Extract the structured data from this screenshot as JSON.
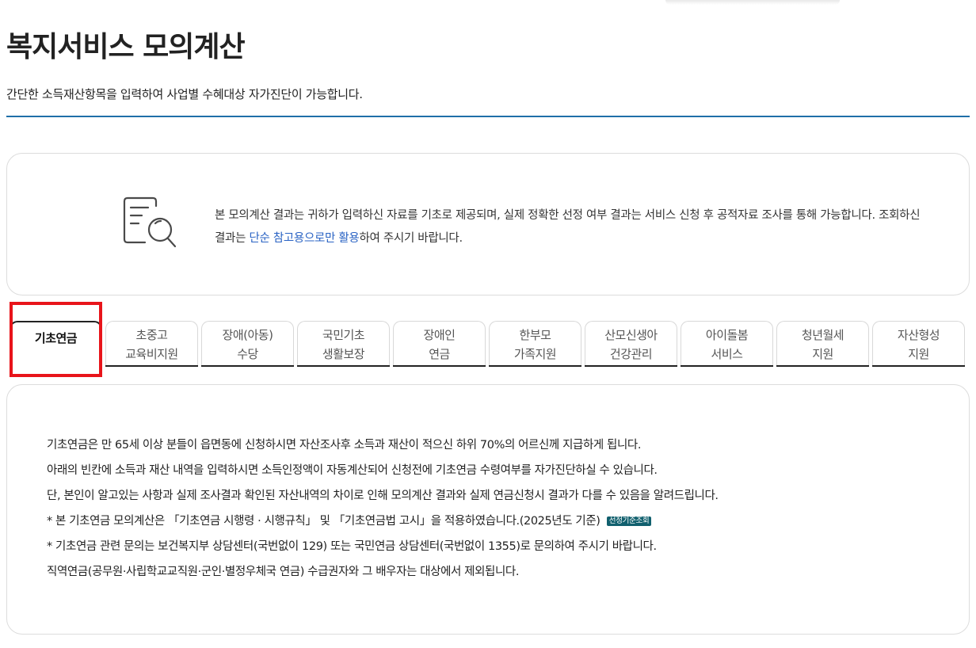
{
  "page": {
    "title": "복지서비스 모의계산",
    "description": "간단한 소득재산항목을 입력하여 사업별 수혜대상 자가진단이 가능합니다."
  },
  "notice": {
    "icon": "document-search-icon",
    "text_before": "본 모의계산 결과는 귀하가 입력하신 자료를 기초로 제공되며, 실제 정확한 선정 여부 결과는 서비스 신청 후 공적자료 조사를 통해 가능합니다. 조회하신 결과는 ",
    "highlight": "단순 참고용으로만 활용",
    "text_after": "하여 주시기 바랍니다."
  },
  "tabs": [
    {
      "line1": "기초연금",
      "line2": "",
      "active": true
    },
    {
      "line1": "초중고",
      "line2": "교육비지원",
      "active": false
    },
    {
      "line1": "장애(아동)",
      "line2": "수당",
      "active": false
    },
    {
      "line1": "국민기초",
      "line2": "생활보장",
      "active": false
    },
    {
      "line1": "장애인",
      "line2": "연금",
      "active": false
    },
    {
      "line1": "한부모",
      "line2": "가족지원",
      "active": false
    },
    {
      "line1": "산모신생아",
      "line2": "건강관리",
      "active": false
    },
    {
      "line1": "아이돌봄",
      "line2": "서비스",
      "active": false
    },
    {
      "line1": "청년월세",
      "line2": "지원",
      "active": false
    },
    {
      "line1": "자산형성",
      "line2": "지원",
      "active": false
    }
  ],
  "info": {
    "line1": "기초연금은 만 65세 이상 분들이 읍면동에 신청하시면 자산조사후 소득과 재산이 적으신 하위 70%의 어르신께 지급하게 됩니다.",
    "line2": "아래의 빈칸에 소득과 재산 내역을 입력하시면 소득인정액이 자동계산되어 신청전에 기초연금 수령여부를 자가진단하실 수 있습니다.",
    "line3": "단, 본인이 알고있는 사항과 실제 조사결과 확인된 자산내역의 차이로 인해 모의계산 결과와 실제 연금신청시 결과가 다를 수 있음을 알려드립니다.",
    "line4": "* 본 기초연금 모의계산은 「기초연금 시행령 · 시행규칙」 및 「기초연금법 고시」을 적용하였습니다.(2025년도 기준)",
    "criteria_button": "선정기준조회",
    "line5": "* 기초연금 관련 문의는 보건복지부 상담센터(국번없이 129) 또는 국민연금 상담센터(국번없이 1355)로 문의하여 주시기 바랍니다.",
    "line6": "직역연금(공무원·사립학교교직원·군인·별정우체국 연금) 수급권자와 그 배우자는 대상에서 제외됩니다."
  },
  "colors": {
    "accent_rule": "#1f6fa8",
    "highlight_link": "#2a63c4",
    "criteria_button": "#11606e",
    "selection_box": "#e8141a"
  }
}
